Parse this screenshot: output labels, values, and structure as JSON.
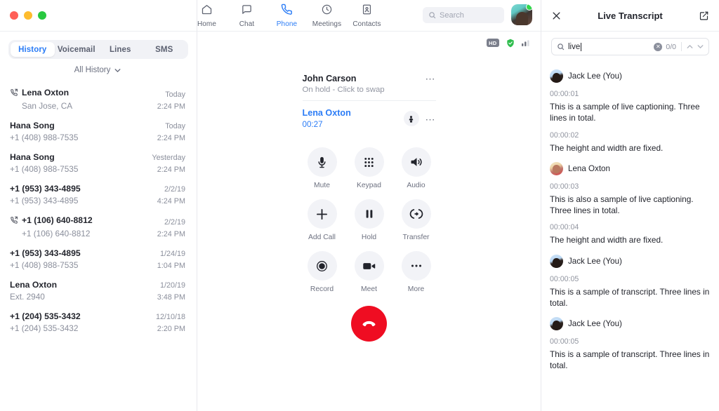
{
  "window": {
    "traffic_lights": [
      "close",
      "minimize",
      "maximize"
    ]
  },
  "topnav": {
    "items": [
      {
        "label": "Home",
        "icon": "home-icon",
        "active": false
      },
      {
        "label": "Chat",
        "icon": "chat-bubble-icon",
        "active": false
      },
      {
        "label": "Phone",
        "icon": "phone-icon",
        "active": true
      },
      {
        "label": "Meetings",
        "icon": "clock-icon",
        "active": false
      },
      {
        "label": "Contacts",
        "icon": "contacts-icon",
        "active": false
      }
    ],
    "search_placeholder": "Search",
    "accent_color": "#2b7cf6"
  },
  "sidebar": {
    "tabs": [
      {
        "label": "History",
        "active": true
      },
      {
        "label": "Voicemail",
        "active": false
      },
      {
        "label": "Lines",
        "active": false
      },
      {
        "label": "SMS",
        "active": false
      }
    ],
    "filter": {
      "label": "All History",
      "icon": "chevron-down-icon"
    },
    "history": [
      {
        "name": "Lena Oxton",
        "sub": "San Jose, CA",
        "date": "Today",
        "time": "2:24 PM",
        "missed": true
      },
      {
        "name": "Hana Song",
        "sub": "+1 (408) 988-7535",
        "date": "Today",
        "time": "2:24 PM",
        "missed": false
      },
      {
        "name": "Hana Song",
        "sub": "+1 (408) 988-7535",
        "date": "Yesterday",
        "time": "2:24 PM",
        "missed": false
      },
      {
        "name": "+1 (953) 343-4895",
        "sub": "+1 (953) 343-4895",
        "date": "2/2/19",
        "time": "4:24 PM",
        "missed": false
      },
      {
        "name": "+1 (106) 640-8812",
        "sub": "+1 (106) 640-8812",
        "date": "2/2/19",
        "time": "2:24 PM",
        "missed": true
      },
      {
        "name": "+1 (953) 343-4895",
        "sub": "+1 (408) 988-7535",
        "date": "1/24/19",
        "time": "1:04 PM",
        "missed": false
      },
      {
        "name": "Lena Oxton",
        "sub": "Ext. 2940",
        "date": "1/20/19",
        "time": "3:48 PM",
        "missed": false
      },
      {
        "name": "+1 (204) 535-3432",
        "sub": "+1 (204) 535-3432",
        "date": "12/10/18",
        "time": "2:20 PM",
        "missed": false
      }
    ]
  },
  "call": {
    "status_icons": {
      "hd_badge": "HD",
      "encryption": "shield-check-icon",
      "signal": "signal-bars-icon"
    },
    "held": {
      "name": "John Carson",
      "status": "On hold - Click to swap",
      "menu": "more-options-icon"
    },
    "active": {
      "name": "Lena Oxton",
      "duration": "00:27",
      "participants_icon": "person-icon",
      "menu": "more-options-icon"
    },
    "controls": [
      {
        "label": "Mute",
        "icon": "microphone-icon"
      },
      {
        "label": "Keypad",
        "icon": "keypad-icon"
      },
      {
        "label": "Audio",
        "icon": "speaker-icon"
      },
      {
        "label": "Add Call",
        "icon": "plus-icon"
      },
      {
        "label": "Hold",
        "icon": "pause-icon"
      },
      {
        "label": "Transfer",
        "icon": "transfer-icon"
      },
      {
        "label": "Record",
        "icon": "record-icon"
      },
      {
        "label": "Meet",
        "icon": "video-camera-icon"
      },
      {
        "label": "More",
        "icon": "ellipsis-icon"
      }
    ],
    "end_call": {
      "icon": "end-call-icon",
      "color": "#ef0d22"
    }
  },
  "transcript": {
    "close_icon": "close-icon",
    "title": "Live Transcript",
    "popout_icon": "pop-out-icon",
    "search": {
      "icon": "search-icon",
      "value": "live",
      "clear_icon": "clear-icon",
      "count": "0/0",
      "prev_icon": "chevron-up-icon",
      "next_icon": "chevron-down-icon"
    },
    "entries": [
      {
        "speaker": "Jack Lee (You)",
        "avatar": "jack",
        "lines": [
          {
            "time": "00:00:01",
            "text": "This is a sample of live captioning. Three lines in total."
          },
          {
            "time": "00:00:02",
            "text": "The height and width are fixed."
          }
        ]
      },
      {
        "speaker": "Lena Oxton",
        "avatar": "lena",
        "lines": [
          {
            "time": "00:00:03",
            "text": "This is also a sample of live captioning. Three lines in total."
          },
          {
            "time": "00:00:04",
            "text": "The height and width are fixed."
          }
        ]
      },
      {
        "speaker": "Jack Lee (You)",
        "avatar": "jack",
        "lines": [
          {
            "time": "00:00:05",
            "text": "This is a sample of transcript. Three lines in total."
          }
        ]
      },
      {
        "speaker": "Jack Lee (You)",
        "avatar": "jack",
        "lines": [
          {
            "time": "00:00:05",
            "text": "This is a sample of transcript. Three lines in total."
          }
        ]
      }
    ]
  }
}
